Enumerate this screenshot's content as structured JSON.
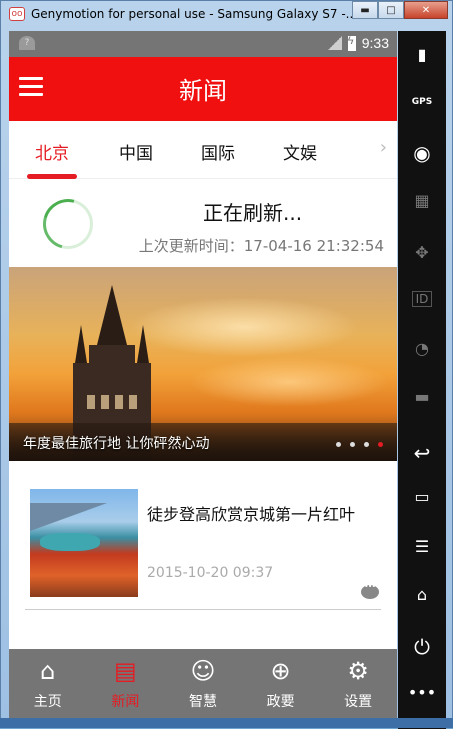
{
  "window": {
    "title": "Genymotion for personal use - Samsung Galaxy S7 -...",
    "logo_text": "oo",
    "minimize": "▬",
    "maximize": "□",
    "close": "✕"
  },
  "status_bar": {
    "time": "9:33"
  },
  "app": {
    "title": "新闻"
  },
  "tabs": [
    "北京",
    "中国",
    "国际",
    "文娱"
  ],
  "tab_more": "›",
  "refresh": {
    "title": "正在刷新...",
    "last_update": "上次更新时间：17-04-16 21:32:54"
  },
  "banner": {
    "caption": "年度最佳旅行地 让你砰然心动",
    "dots": 4,
    "active_dot": 3
  },
  "news": [
    {
      "title": "徒步登高欣赏京城第一片红叶",
      "date": "2015-10-20 09:37"
    }
  ],
  "bottom_nav": [
    {
      "label": "主页",
      "icon": "home-icon",
      "glyph": "⌂"
    },
    {
      "label": "新闻",
      "icon": "news-icon",
      "glyph": "▤"
    },
    {
      "label": "智慧",
      "icon": "smile-icon",
      "glyph": "☺"
    },
    {
      "label": "政要",
      "icon": "globe-icon",
      "glyph": "⊕"
    },
    {
      "label": "设置",
      "icon": "gear-icon",
      "glyph": "⚙"
    }
  ],
  "emulator_sidebar": {
    "gps_label": "GPS",
    "id_label": "ID"
  },
  "colors": {
    "accent": "#f01010",
    "status_bar": "#757575",
    "bottom_nav": "#757575"
  }
}
